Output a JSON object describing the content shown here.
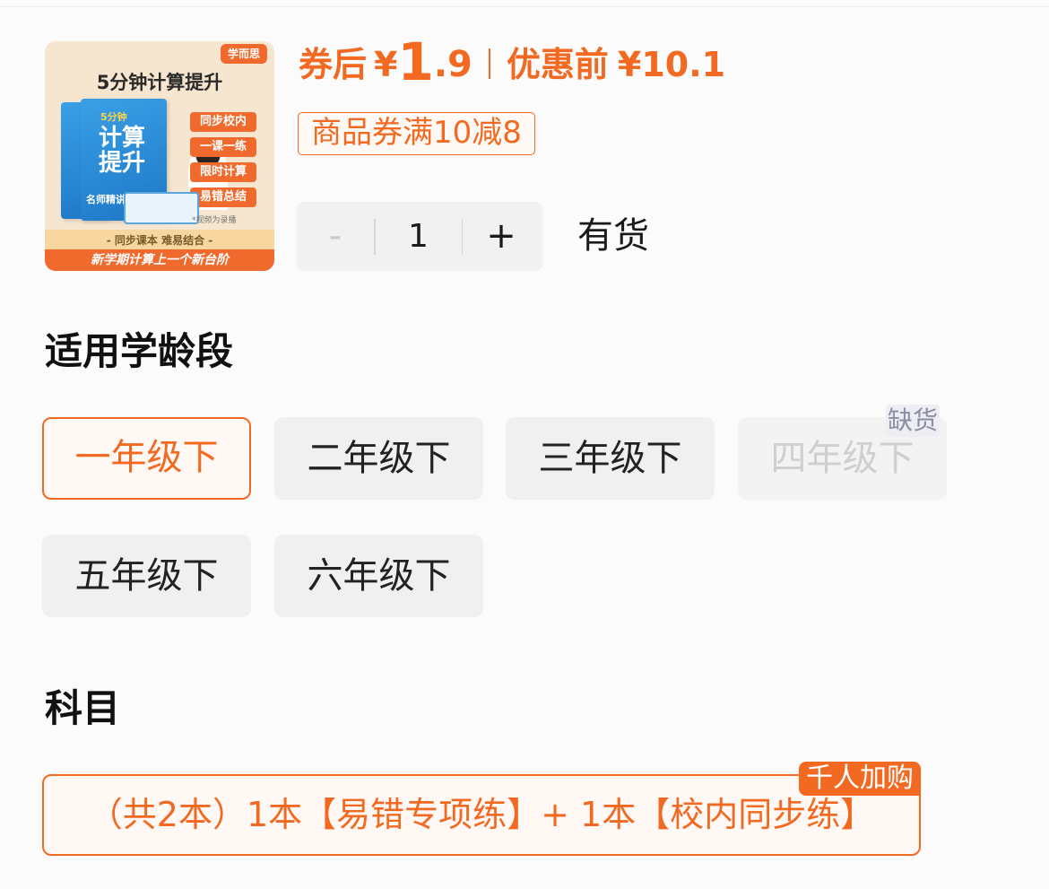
{
  "product_image": {
    "brand": "学而思",
    "title": "5分钟计算提升",
    "book_title": "计算提升",
    "book_tag": "5分钟",
    "book_sub": "名师精讲",
    "tags": [
      "同步校内",
      "一课一练",
      "限时计算",
      "易错总结"
    ],
    "note": "*视频为录播",
    "band": "- 同步课本 难易结合 -",
    "footer": "新学期计算上一个新台阶"
  },
  "price": {
    "label": "券后",
    "yen": "¥",
    "integer": "1",
    "decimal": ".9",
    "original_label": "优惠前",
    "original_price": "¥10.1",
    "color": "#f26a22"
  },
  "coupon": "商品券满10减8",
  "quantity": {
    "minus": "-",
    "value": "1",
    "plus": "+"
  },
  "stock_status": "有货",
  "grade_section": {
    "title": "适用学龄段",
    "options": [
      {
        "label": "一年级下",
        "state": "selected"
      },
      {
        "label": "二年级下",
        "state": "normal"
      },
      {
        "label": "三年级下",
        "state": "normal"
      },
      {
        "label": "四年级下",
        "state": "disabled",
        "badge": "缺货"
      },
      {
        "label": "五年级下",
        "state": "normal"
      },
      {
        "label": "六年级下",
        "state": "normal"
      }
    ]
  },
  "subject_section": {
    "title": "科目",
    "option": {
      "label": "（共2本）1本【易错专项练】+ 1本【校内同步练】",
      "badge": "千人加购",
      "state": "selected"
    }
  }
}
